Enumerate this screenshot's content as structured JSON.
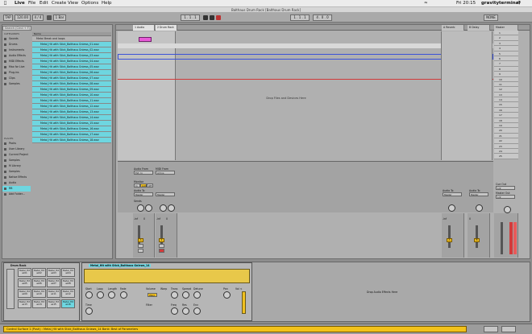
{
  "menubar": {
    "app": "Live",
    "items": [
      "File",
      "Edit",
      "Create",
      "View",
      "Options",
      "Help"
    ],
    "clock": "Fri 20:15",
    "user": "gravityterminal"
  },
  "window": {
    "title": "Balthaus Drum Rack [Balthaus Drum Rack]"
  },
  "transport": {
    "tempo": "120.00",
    "signature": "4 / 4",
    "position": "1 . 1 . 1",
    "quantize": "1 Bar",
    "loop_end": "4 . 0 . 0",
    "cpu": "NONE"
  },
  "browser": {
    "search_placeholder": "Search (Cmd + F)",
    "collections_header": "CATEGORIES",
    "categories": [
      "Sounds",
      "Drums",
      "Instruments",
      "Audio Effects",
      "MIDI Effects",
      "Max for Live",
      "Plug-ins",
      "Clips",
      "Samples"
    ],
    "places_header": "PLACES",
    "places": [
      "Packs",
      "User Library",
      "Current Project",
      "Samples",
      "M Library",
      "Samples",
      "Native Effects",
      "Audio",
      "RB",
      "Add Folder..."
    ],
    "name_header": "Name",
    "folder": "Metal Break and loops",
    "files": [
      "Metal_Hit with Stick_Balthaus Gniews_01.wav",
      "Metal_Hit with Stick_Balthaus Gniews_02.wav",
      "Metal_Hit with Stick_Balthaus Gniews_03.wav",
      "Metal_Hit with Stick_Balthaus Gniews_04.wav",
      "Metal_Hit with Stick_Balthaus Gniews_05.wav",
      "Metal_Hit with Stick_Balthaus Gniews_06.wav",
      "Metal_Hit with Stick_Balthaus Gniews_07.wav",
      "Metal_Hit with Stick_Balthaus Gniews_08.wav",
      "Metal_Hit with Stick_Balthaus Gniews_09.wav",
      "Metal_Hit with Stick_Balthaus Gniews_10.wav",
      "Metal_Hit with Stick_Balthaus Gniews_11.wav",
      "Metal_Hit with Stick_Balthaus Gniews_12.wav",
      "Metal_Hit with Stick_Balthaus Gniews_13.wav",
      "Metal_Hit with Stick_Balthaus Gniews_14.wav",
      "Metal_Hit with Stick_Balthaus Gniews_15.wav",
      "Metal_Hit with Stick_Balthaus Gniews_16.wav",
      "Metal_Hit with Stick_Balthaus Gniews_17.wav",
      "Metal_Hit with Stick_Balthaus Gniews_18.wav"
    ]
  },
  "session": {
    "tracks": [
      {
        "name": "1 Audio",
        "color": "#e2e2e2"
      },
      {
        "name": "2 Drum Rack",
        "color": "#e2e2e2"
      }
    ],
    "returns": [
      {
        "name": "A Reverb"
      },
      {
        "name": "B Delay"
      }
    ],
    "master": {
      "name": "Master",
      "scenes": [
        "1",
        "2",
        "3",
        "4",
        "5",
        "6",
        "7",
        "8",
        "9",
        "10",
        "11",
        "12",
        "13",
        "14",
        "15",
        "16",
        "17",
        "18",
        "19",
        "20",
        "21",
        "22",
        "23",
        "24",
        "25",
        "26",
        "27",
        "28",
        "29",
        "30"
      ]
    },
    "drop_hint": "Drop Files and Devices Here",
    "io": {
      "audio_from": "Audio From",
      "ext_in": "Ext. In",
      "midi_from": "MIDI From",
      "all_ins": "All Ins",
      "monitor": "Monitor",
      "in": "In",
      "auto": "Auto",
      "off": "Off",
      "audio_to": "Audio To",
      "master": "Master",
      "cue_out": "Cue Out",
      "master_out": "Master Out",
      "sends": "Sends"
    },
    "mixer_values": [
      "-inf",
      "0",
      "-inf",
      "0",
      "-inf",
      "0"
    ]
  },
  "devices": {
    "drum_rack_title": "Drum Rack",
    "pads": [
      "Metal_Hit wi01",
      "Metal_Hit wi02",
      "Metal_Hit wi03",
      "Metal_Hit wi04",
      "Metal_Hit wi05",
      "Metal_Hit wi06",
      "Metal_Hit wi07",
      "Metal_Hit wi08",
      "Metal_Hit wi09",
      "Metal_Hit wi10",
      "Metal_Hit wi11",
      "Metal_Hit wi12",
      "Metal_Hit wi13",
      "Metal_Hit wi14",
      "Metal_Hit wi15",
      "Metal_Hit wi16"
    ],
    "sampler_title": "Metal_Hit with Stick_Balthaus Gniews_14",
    "sampler_labels": [
      "Start",
      "Loop",
      "Length",
      "Fade",
      "Volume",
      "Warp",
      "Trans",
      "Spread",
      "Detune",
      "Pan",
      "Vol <",
      "Time",
      "Filter",
      "Freq",
      "Res",
      "Env"
    ],
    "drop_effects": "Drop Audio Effects Here"
  },
  "status": {
    "message": "Control Surface 1 (Push) : Metal_Hit with Stick_Balthaus Gniews_14 Bank: Best of Parameters"
  },
  "colors": {
    "accent": "#6ed6e0",
    "status": "#f2c21b",
    "record": "#d23b3b"
  }
}
